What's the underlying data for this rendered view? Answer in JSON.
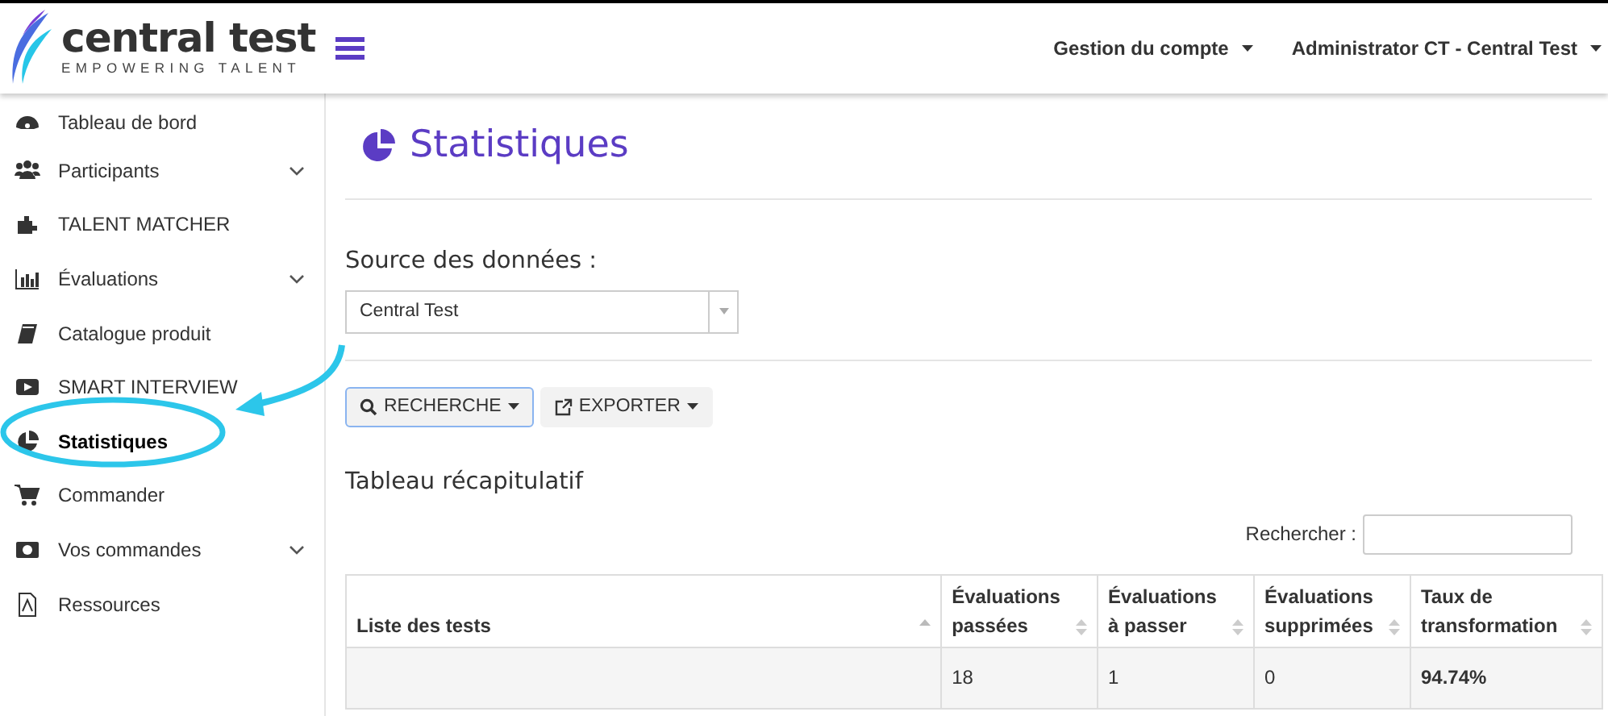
{
  "brand": {
    "name": "central test",
    "tagline": "EMPOWERING TALENT"
  },
  "top_menu": [
    {
      "label": "Gestion du compte"
    },
    {
      "label": "Administrator CT - Central Test"
    }
  ],
  "sidebar": {
    "items": [
      {
        "label": "Tableau de bord",
        "selected": false,
        "expandable": false
      },
      {
        "label": "Participants",
        "selected": false,
        "expandable": true
      },
      {
        "label": "TALENT MATCHER",
        "selected": false,
        "expandable": false
      },
      {
        "label": "Évaluations",
        "selected": false,
        "expandable": true
      },
      {
        "label": "Catalogue produit",
        "selected": false,
        "expandable": false
      },
      {
        "label": "SMART INTERVIEW",
        "selected": false,
        "expandable": false
      },
      {
        "label": "Statistiques",
        "selected": true,
        "expandable": false
      },
      {
        "label": "Commander",
        "selected": false,
        "expandable": false
      },
      {
        "label": "Vos commandes",
        "selected": false,
        "expandable": true
      },
      {
        "label": "Ressources",
        "selected": false,
        "expandable": false
      }
    ]
  },
  "page_title": "Statistiques",
  "source": {
    "label": "Source des données :",
    "value": "Central Test"
  },
  "buttons": [
    {
      "label": "RECHERCHE",
      "focused": true
    },
    {
      "label": "EXPORTER",
      "focused": false
    }
  ],
  "summary": {
    "title": "Tableau récapitulatif",
    "search_label": "Rechercher :",
    "columns": [
      {
        "label": "Liste des tests",
        "sorted": true
      },
      {
        "label": "Évaluations passées",
        "sorted": false
      },
      {
        "label": "Évaluations à passer",
        "sorted": false
      },
      {
        "label": "Évaluations supprimées",
        "sorted": false
      },
      {
        "label": "Taux de transformation",
        "sorted": false
      }
    ],
    "rows": [
      {
        "cells": [
          {},
          {
            "text": "18",
            "bold": false
          },
          {
            "text": "1",
            "bold": false
          },
          {
            "text": "0",
            "bold": false
          },
          {
            "text": "94.74%",
            "bold": true
          }
        ]
      }
    ]
  }
}
